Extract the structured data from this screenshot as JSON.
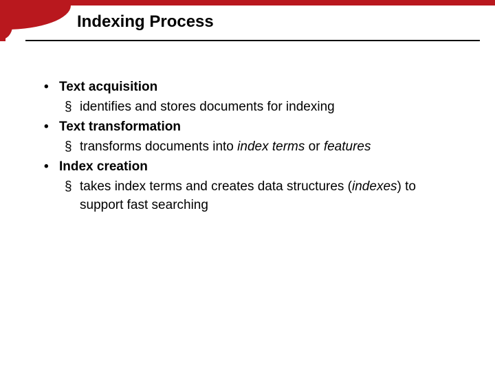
{
  "title": "Indexing Process",
  "bullets": {
    "b1a": "Text acquisition",
    "b2a": "identifies and stores documents for indexing",
    "b1b": "Text transformation",
    "b2b_pre": "transforms documents into ",
    "b2b_i1": "index terms",
    "b2b_mid": " or ",
    "b2b_i2": "features",
    "b1c": "Index creation",
    "b2c_pre": "takes index terms and creates data structures (",
    "b2c_i1": "indexes",
    "b2c_post": ") to support fast searching"
  }
}
